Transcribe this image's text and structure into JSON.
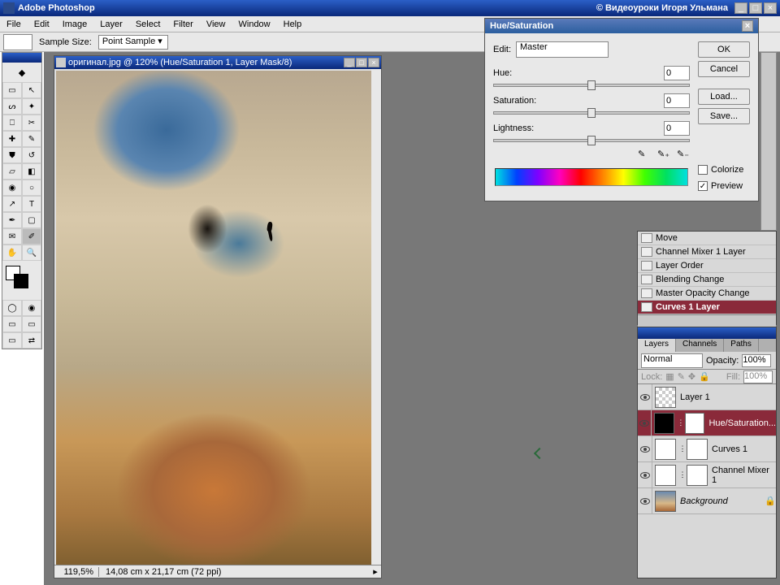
{
  "app": {
    "title": "Adobe Photoshop",
    "credit": "© Видеоуроки Игоря Ульмана"
  },
  "menu": [
    "File",
    "Edit",
    "Image",
    "Layer",
    "Select",
    "Filter",
    "View",
    "Window",
    "Help"
  ],
  "options": {
    "sample_label": "Sample Size:",
    "sample_value": "Point Sample"
  },
  "doc": {
    "title": "оригинал.jpg @ 120% (Hue/Saturation 1, Layer Mask/8)",
    "zoom": "119,5%",
    "info": "14,08 cm x 21,17 cm (72 ppi)"
  },
  "dialog": {
    "title": "Hue/Saturation",
    "edit_label": "Edit:",
    "edit_value": "Master",
    "hue_label": "Hue:",
    "hue_value": "0",
    "sat_label": "Saturation:",
    "sat_value": "0",
    "light_label": "Lightness:",
    "light_value": "0",
    "colorize_label": "Colorize",
    "preview_label": "Preview",
    "ok": "OK",
    "cancel": "Cancel",
    "load": "Load...",
    "save": "Save..."
  },
  "history": {
    "items": [
      "Move",
      "Channel Mixer 1 Layer",
      "Layer Order",
      "Blending Change",
      "Master Opacity Change",
      "Curves 1 Layer"
    ],
    "active_index": 5
  },
  "layers": {
    "tabs": [
      "Layers",
      "Channels",
      "Paths"
    ],
    "blend_mode": "Normal",
    "opacity_label": "Opacity:",
    "opacity_value": "100%",
    "lock_label": "Lock:",
    "fill_label": "Fill:",
    "fill_value": "100%",
    "items": [
      {
        "name": "Layer 1",
        "thumb": "checker",
        "mask": null,
        "active": false,
        "italic": false,
        "locked": false
      },
      {
        "name": "Hue/Saturation...",
        "thumb": "black",
        "mask": "white",
        "active": true,
        "italic": false,
        "locked": false
      },
      {
        "name": "Curves 1",
        "thumb": "curves",
        "mask": "white",
        "active": false,
        "italic": false,
        "locked": false
      },
      {
        "name": "Channel Mixer 1",
        "thumb": "mixer",
        "mask": "white",
        "active": false,
        "italic": false,
        "locked": false
      },
      {
        "name": "Background",
        "thumb": "sky",
        "mask": null,
        "active": false,
        "italic": true,
        "locked": true
      }
    ]
  }
}
